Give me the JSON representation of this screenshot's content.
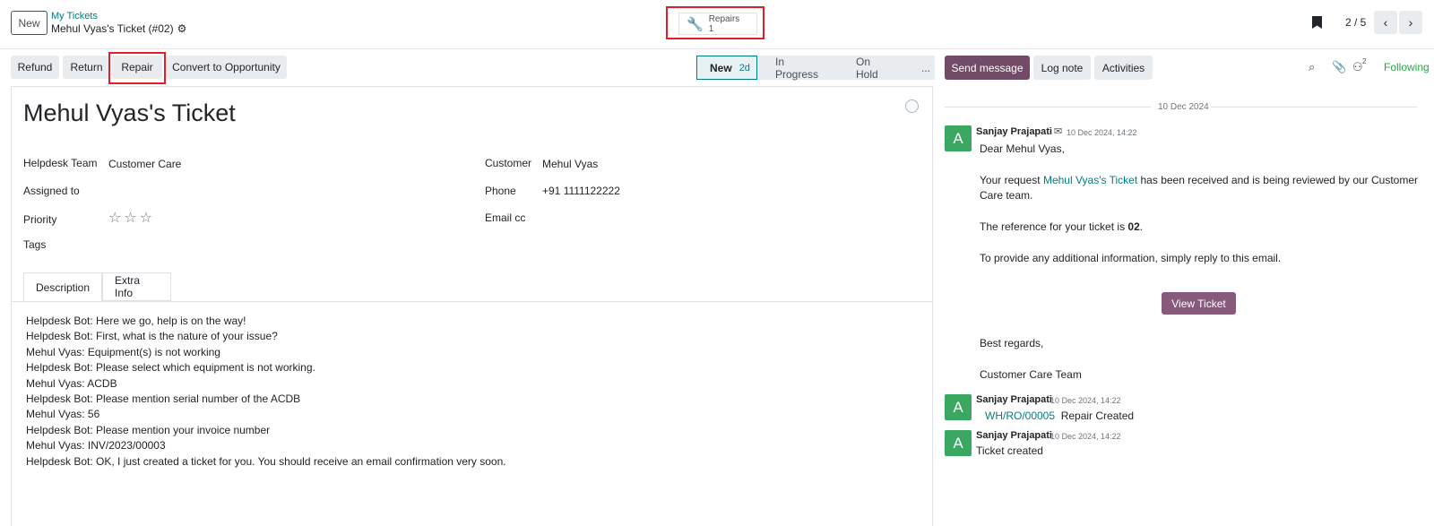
{
  "topbar": {
    "new_label": "New",
    "breadcrumb": "My Tickets",
    "record_title": "Mehul Vyas's Ticket (#02)",
    "repairs_label": "Repairs",
    "repairs_count": "1",
    "pager": "2 / 5"
  },
  "actions": {
    "refund": "Refund",
    "return": "Return",
    "repair": "Repair",
    "convert": "Convert to Opportunity"
  },
  "stages": {
    "new": "New",
    "new_days": "2d",
    "in_progress": "In Progress",
    "on_hold": "On Hold",
    "more": "..."
  },
  "form": {
    "title": "Mehul Vyas's Ticket",
    "helpdesk_team_label": "Helpdesk Team",
    "helpdesk_team_value": "Customer Care",
    "assigned_to_label": "Assigned to",
    "priority_label": "Priority",
    "priority_stars": 0,
    "tags_label": "Tags",
    "customer_label": "Customer",
    "customer_value": "Mehul Vyas",
    "phone_label": "Phone",
    "phone_value": "+91 1111122222",
    "email_cc_label": "Email cc",
    "tabs": [
      "Description",
      "Extra Info"
    ],
    "description": [
      "Helpdesk Bot: Here we go, help is on the way!",
      "Helpdesk Bot: First, what is the nature of your issue?",
      "Mehul Vyas: Equipment(s) is not working",
      "Helpdesk Bot: Please select which equipment is not working.",
      "Mehul Vyas: ACDB",
      "Helpdesk Bot: Please mention serial number of the ACDB",
      "Mehul Vyas: 56",
      "Helpdesk Bot: Please mention your invoice number",
      "Mehul Vyas: INV/2023/00003",
      "Helpdesk Bot: OK, I just created a ticket for you. You should receive an email confirmation very soon."
    ]
  },
  "chatter": {
    "send_message": "Send message",
    "log_note": "Log note",
    "activities": "Activities",
    "followers_count": "2",
    "following": "Following",
    "date_separator": "10 Dec 2024",
    "messages": [
      {
        "avatar": "A",
        "author": "Sanjay Prajapati",
        "time": "10 Dec 2024, 14:22",
        "greeting": "Dear Mehul Vyas,",
        "p1_before": "Your request ",
        "p1_link": "Mehul Vyas's Ticket",
        "p1_after": " has been received and is being reviewed by our Customer",
        "p1_line2": "Care team.",
        "p2_before": "The reference for your ticket is ",
        "p2_ref": "02",
        "p2_after": ".",
        "p3": "To provide any additional information, simply reply to this email.",
        "button": "View Ticket",
        "closing": "Best regards,",
        "signature": "Customer Care Team"
      },
      {
        "avatar": "A",
        "author": "Sanjay Prajapati",
        "time": "10 Dec 2024, 14:22",
        "link": "WH/RO/00005",
        "text": "Repair Created"
      },
      {
        "avatar": "A",
        "author": "Sanjay Prajapati",
        "time": "10 Dec 2024, 14:22",
        "text": "Ticket created"
      }
    ]
  },
  "colors": {
    "primary": "#714b67",
    "link": "#017e84",
    "avatar": "#3aa861",
    "highlight": "#e41e26",
    "following": "#28a745"
  }
}
